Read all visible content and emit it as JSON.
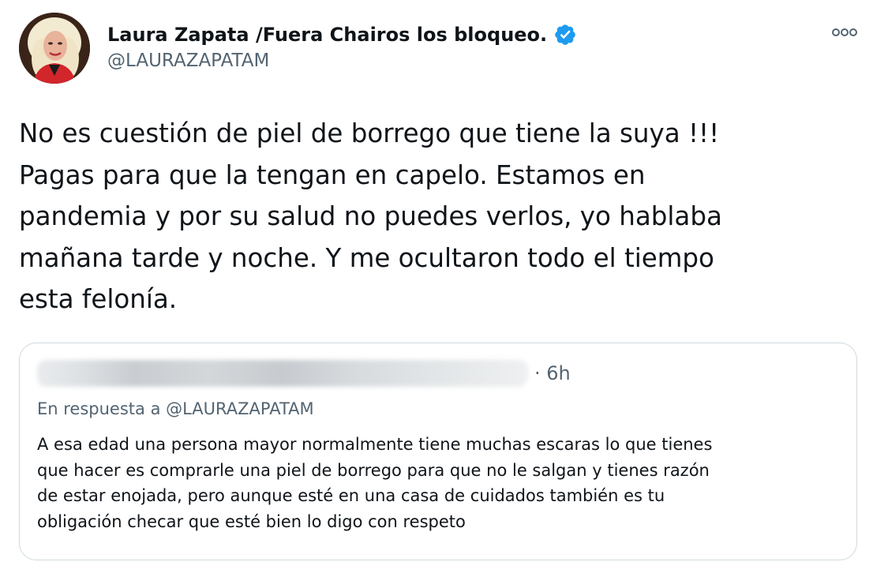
{
  "tweet": {
    "author": {
      "display_name": "Laura Zapata /Fuera Chairos los bloqueo.",
      "handle": "@LAURAZAPATAM",
      "verified": true,
      "verified_icon": "verified-badge-icon"
    },
    "more_icon": "more-options-icon",
    "text": "No es cuestión de piel de borrego que tiene la suya !!!\nPagas para que la tengan en capelo. Estamos en\npandemia y por su salud no puedes verlos, yo hablaba\nmañana tarde y noche. Y me ocultaron todo el tiempo\nesta felonía.",
    "quoted_tweet": {
      "time": "· 6h",
      "reply_prefix": "En respuesta a ",
      "reply_mention": "@LAURAZAPATAM",
      "text": "A esa edad una persona mayor normalmente tiene muchas escaras lo que tienes\nque hacer es comprarle una piel de borrego para que no le salgan y tienes razón\nde estar enojada, pero aunque esté en una casa de cuidados también es tu\nobligación checar que esté bien lo digo con respeto"
    }
  },
  "colors": {
    "text_primary": "#0f1419",
    "text_secondary": "#536471",
    "verified_blue": "#1d9bf0",
    "border": "#cfd9de"
  }
}
